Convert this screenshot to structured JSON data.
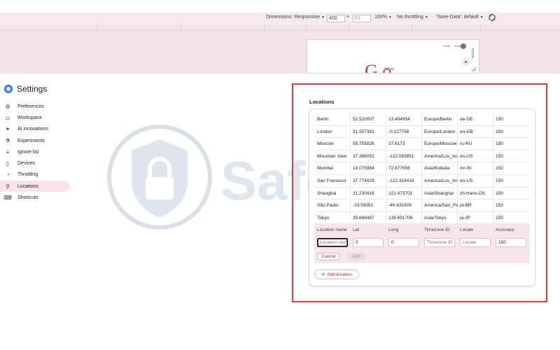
{
  "toolbar": {
    "dimensions_label": "Dimensions: Responsive",
    "width_value": "400",
    "times_symbol": "×",
    "height_value": "63",
    "zoom": "100%",
    "throttling": "No throttling",
    "save_data": "'Save-Data': default",
    "rotate_icon": "rotate-icon"
  },
  "preview": {
    "header_links": [
      "Gmail",
      "Images"
    ],
    "logo_text": "G o"
  },
  "sidebar": {
    "title": "Settings",
    "items": [
      {
        "label": "Preferences",
        "icon": "gear-icon",
        "active": false
      },
      {
        "label": "Workspace",
        "icon": "folder-icon",
        "active": false
      },
      {
        "label": "AI innovations",
        "icon": "sparkle-icon",
        "active": false
      },
      {
        "label": "Experiments",
        "icon": "flask-icon",
        "active": false
      },
      {
        "label": "Ignore list",
        "icon": "filter-list-icon",
        "active": false
      },
      {
        "label": "Devices",
        "icon": "devices-icon",
        "active": false
      },
      {
        "label": "Throttling",
        "icon": "speedometer-icon",
        "active": false
      },
      {
        "label": "Locations",
        "icon": "pin-icon",
        "active": true
      },
      {
        "label": "Shortcuts",
        "icon": "keyboard-icon",
        "active": false
      }
    ]
  },
  "watermark": {
    "text": "Safelyo"
  },
  "locations": {
    "title": "Locations",
    "rows": [
      [
        "Berlin",
        "52.520007",
        "13.404954",
        "Europe/Berlin",
        "de-DE",
        "150"
      ],
      [
        "London",
        "51.507351",
        "-0.127758",
        "Europe/London",
        "en-GB",
        "150"
      ],
      [
        "Moscow",
        "55.755826",
        "37.6173",
        "Europe/Moscow",
        "ru-RU",
        "150"
      ],
      [
        "Mountain View",
        "37.386052",
        "-122.083851",
        "America/Los_Angeles",
        "en-US",
        "150"
      ],
      [
        "Mumbai",
        "19.075984",
        "72.877656",
        "Asia/Kolkata",
        "mr-IN",
        "150"
      ],
      [
        "San Francisco",
        "37.774929",
        "-122.419416",
        "America/Los_Angeles",
        "en-US",
        "150"
      ],
      [
        "Shanghai",
        "31.230416",
        "121.473701",
        "Asia/Shanghai",
        "zh-Hans-CN",
        "150"
      ],
      [
        "São Paulo",
        "-23.55052",
        "-46.633309",
        "America/Sao_Paulo",
        "pt-BR",
        "150"
      ],
      [
        "Tokyo",
        "35.689487",
        "139.691706",
        "Asia/Tokyo",
        "ja-JP",
        "150"
      ]
    ],
    "form": {
      "labels": [
        "Location name",
        "Lat",
        "Long",
        "Timezone ID",
        "Locale",
        "Accuracy"
      ],
      "name_placeholder": "Location name",
      "lat_value": "0",
      "long_value": "0",
      "timezone_placeholder": "Timezone ID",
      "locale_placeholder": "Locale",
      "accuracy_value": "150",
      "cancel_label": "Cancel",
      "add_label": "Add"
    },
    "add_location_label": "Add location"
  }
}
